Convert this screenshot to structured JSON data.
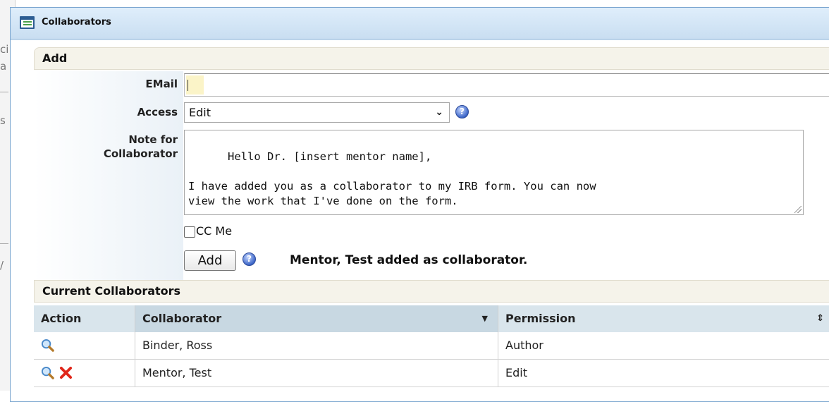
{
  "window": {
    "title": "Collaborators",
    "title_icon": "window-list-icon"
  },
  "background": {
    "fragments": [
      "ci",
      "a",
      "s",
      "/"
    ]
  },
  "add_section": {
    "heading": "Add",
    "email_label": "EMail",
    "email_value": "",
    "access_label": "Access",
    "access_selected": "Edit",
    "note_label_line1": "Note for",
    "note_label_line2": "Collaborator",
    "note_text": "Hello Dr. [insert mentor name],\n\nI have added you as a collaborator to my IRB form. You can now\nview the work that I've done on the form.",
    "cc_label": "CC Me",
    "cc_checked": false,
    "add_button": "Add",
    "status_message": "Mentor, Test added as collaborator."
  },
  "collaborators": {
    "heading": "Current Collaborators",
    "columns": [
      "Action",
      "Collaborator",
      "Permission"
    ],
    "rows": [
      {
        "name": "Binder, Ross",
        "permission": "Author",
        "actions": [
          "view-icon"
        ]
      },
      {
        "name": "Mentor, Test",
        "permission": "Edit",
        "actions": [
          "view-icon",
          "delete-icon"
        ]
      }
    ]
  },
  "colors": {
    "title_bar": "#c9def1",
    "section_bar": "#f5f3ea",
    "table_header": "#d9e5ec",
    "delete": "#e0261a"
  }
}
